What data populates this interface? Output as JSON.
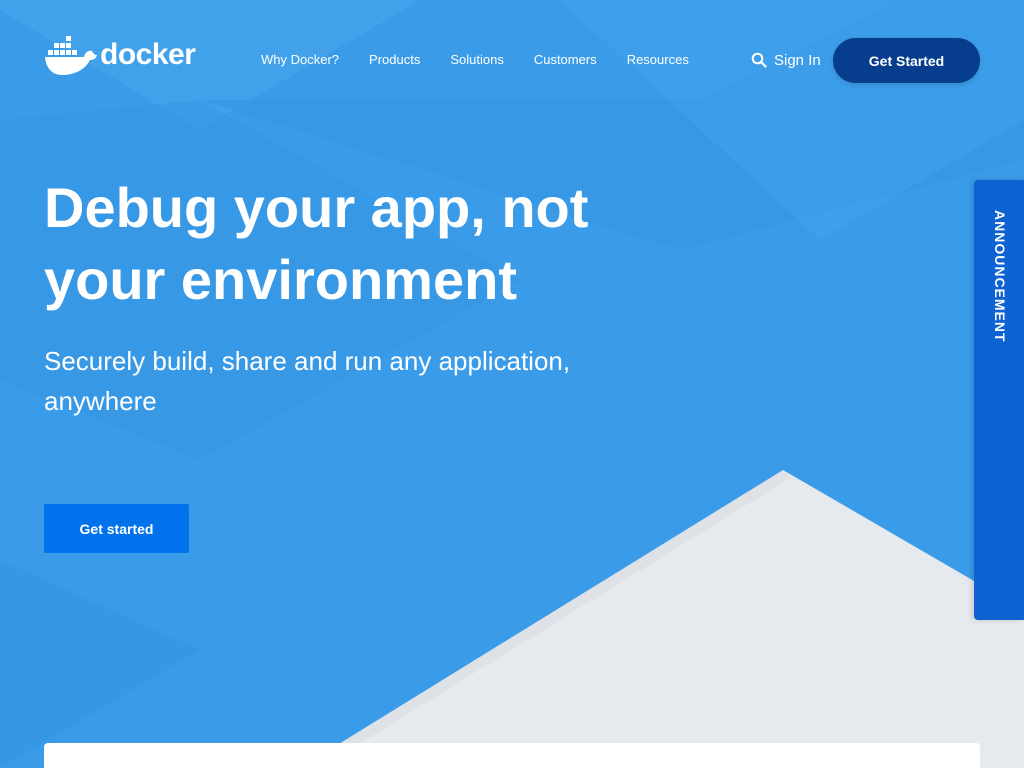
{
  "brand": {
    "name": "docker",
    "logo_icon": "docker-whale-icon"
  },
  "nav": {
    "items": [
      {
        "label": "Why Docker?"
      },
      {
        "label": "Products"
      },
      {
        "label": "Solutions"
      },
      {
        "label": "Customers"
      },
      {
        "label": "Resources"
      }
    ],
    "search_icon": "search-icon",
    "sign_in_label": "Sign In",
    "cta_label": "Get Started"
  },
  "hero": {
    "title": "Debug your app, not your environment",
    "subtitle": "Securely build, share and run any application, anywhere",
    "cta_label": "Get started"
  },
  "announcement": {
    "label": "ANNOUNCEMENT"
  },
  "colors": {
    "background": "#3a9ce9",
    "header_cta": "#063d8c",
    "hero_cta": "#0073ec",
    "announcement_tab": "#0e63d3",
    "white": "#ffffff"
  }
}
